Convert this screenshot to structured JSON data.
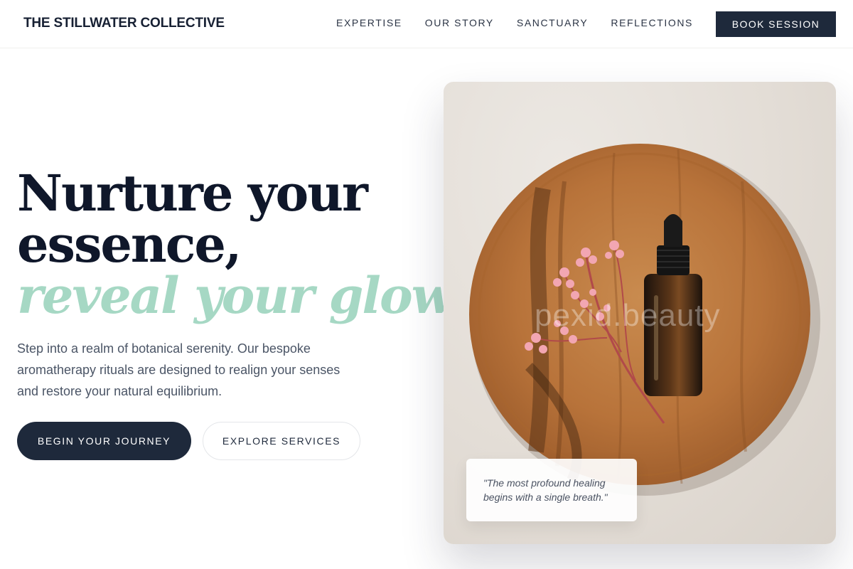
{
  "brand": "THE STILLWATER COLLECTIVE",
  "nav": {
    "links": [
      "EXPERTISE",
      "OUR STORY",
      "SANCTUARY",
      "REFLECTIONS"
    ],
    "cta": "BOOK SESSION"
  },
  "hero": {
    "title_line1": "Nurture your",
    "title_line2": "essence,",
    "title_accent": "reveal your glow.",
    "description": "Step into a realm of botanical serenity. Our bespoke aromatherapy rituals are designed to realign your senses and restore your natural equilibrium.",
    "primary_button": "BEGIN YOUR JOURNEY",
    "secondary_button": "EXPLORE SERVICES"
  },
  "image": {
    "watermark": "pexid.beauty",
    "quote": "\"The most profound healing begins with a single breath.\""
  },
  "colors": {
    "navy": "#1e293b",
    "accent_mint": "#a6d8c4",
    "wood": "#b8733a",
    "background": "#ffffff"
  },
  "icons": [
    "essential-oil-bottle",
    "dried-flower-sprig",
    "wooden-plate"
  ]
}
